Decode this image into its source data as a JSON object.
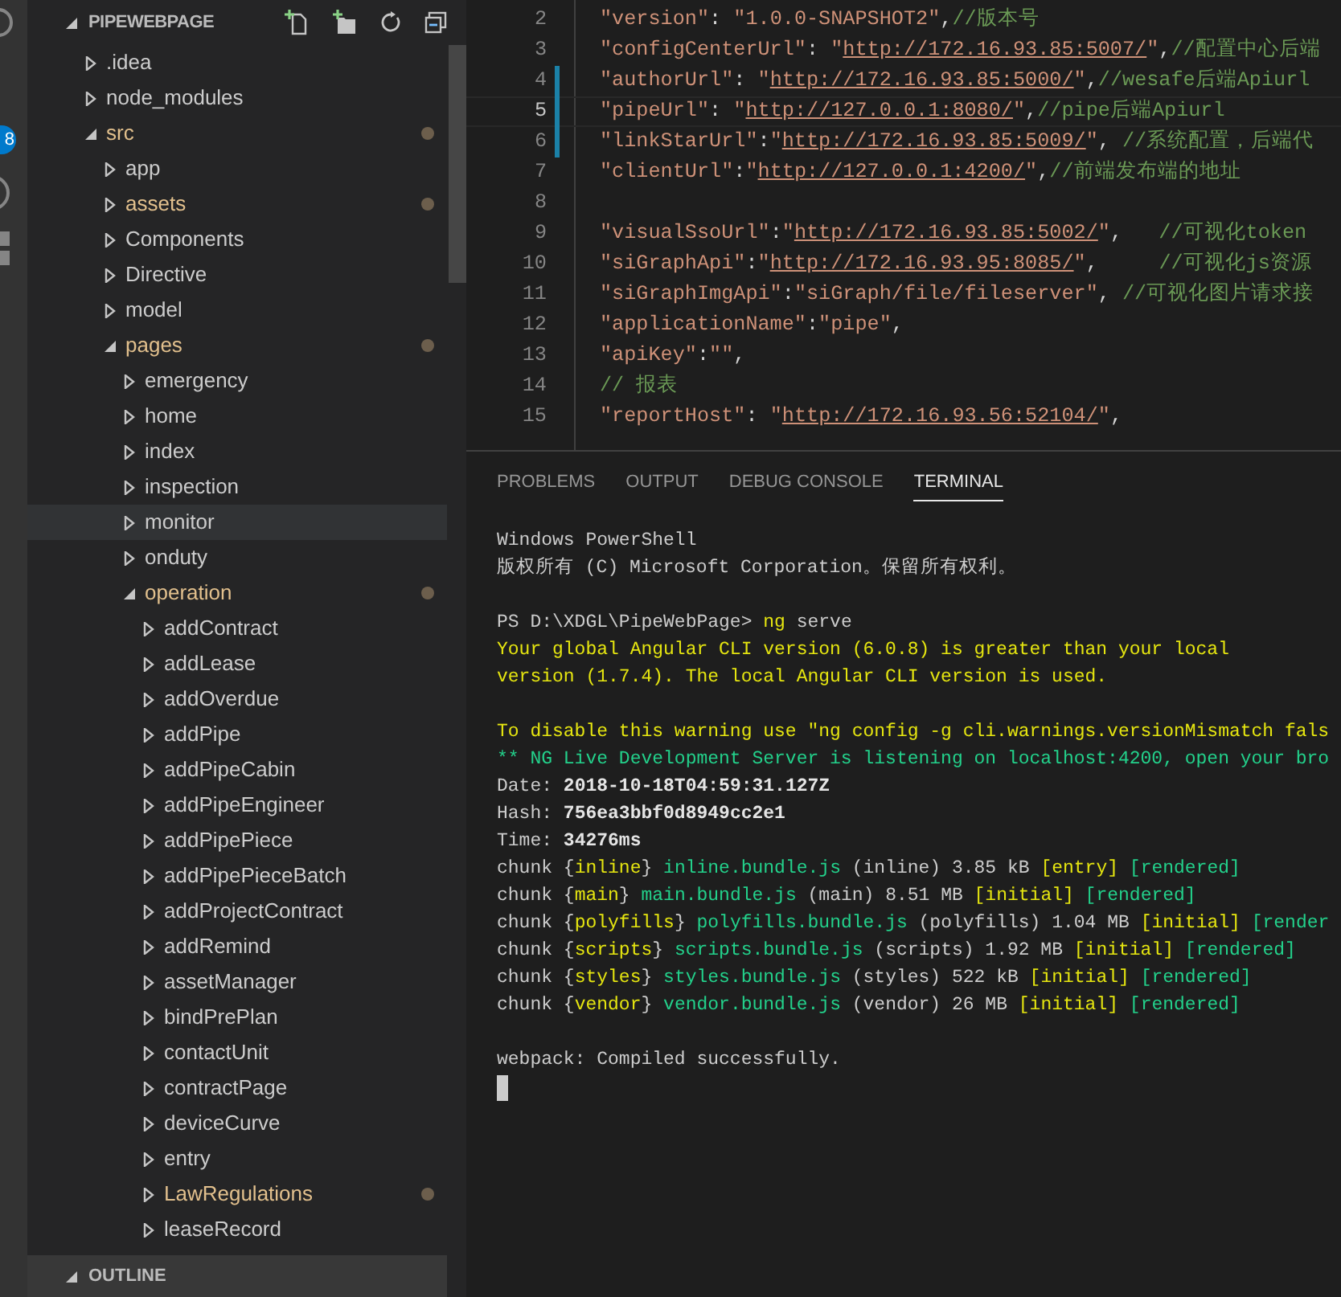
{
  "activity_bar": {
    "badge": "8"
  },
  "explorer": {
    "title": "PIPEWEBPAGE",
    "expanded": true,
    "tree": [
      {
        "label": ".idea",
        "expanded": false,
        "modified": false,
        "hovered": false
      },
      {
        "label": "node_modules",
        "expanded": false,
        "modified": false,
        "hovered": false
      },
      {
        "label": "src",
        "expanded": true,
        "modified": true,
        "hovered": false,
        "children": [
          {
            "label": "app",
            "expanded": false,
            "modified": false,
            "hovered": false
          },
          {
            "label": "assets",
            "expanded": false,
            "modified": true,
            "hovered": false
          },
          {
            "label": "Components",
            "expanded": false,
            "modified": false,
            "hovered": false
          },
          {
            "label": "Directive",
            "expanded": false,
            "modified": false,
            "hovered": false
          },
          {
            "label": "model",
            "expanded": false,
            "modified": false,
            "hovered": false
          },
          {
            "label": "pages",
            "expanded": true,
            "modified": true,
            "hovered": false,
            "children": [
              {
                "label": "emergency",
                "expanded": false,
                "modified": false,
                "hovered": false
              },
              {
                "label": "home",
                "expanded": false,
                "modified": false,
                "hovered": false
              },
              {
                "label": "index",
                "expanded": false,
                "modified": false,
                "hovered": false
              },
              {
                "label": "inspection",
                "expanded": false,
                "modified": false,
                "hovered": false
              },
              {
                "label": "monitor",
                "expanded": false,
                "modified": false,
                "hovered": true
              },
              {
                "label": "onduty",
                "expanded": false,
                "modified": false,
                "hovered": false
              },
              {
                "label": "operation",
                "expanded": true,
                "modified": true,
                "hovered": false,
                "children": [
                  {
                    "label": "addContract",
                    "expanded": false,
                    "modified": false,
                    "hovered": false
                  },
                  {
                    "label": "addLease",
                    "expanded": false,
                    "modified": false,
                    "hovered": false
                  },
                  {
                    "label": "addOverdue",
                    "expanded": false,
                    "modified": false,
                    "hovered": false
                  },
                  {
                    "label": "addPipe",
                    "expanded": false,
                    "modified": false,
                    "hovered": false
                  },
                  {
                    "label": "addPipeCabin",
                    "expanded": false,
                    "modified": false,
                    "hovered": false
                  },
                  {
                    "label": "addPipeEngineer",
                    "expanded": false,
                    "modified": false,
                    "hovered": false
                  },
                  {
                    "label": "addPipePiece",
                    "expanded": false,
                    "modified": false,
                    "hovered": false
                  },
                  {
                    "label": "addPipePieceBatch",
                    "expanded": false,
                    "modified": false,
                    "hovered": false
                  },
                  {
                    "label": "addProjectContract",
                    "expanded": false,
                    "modified": false,
                    "hovered": false
                  },
                  {
                    "label": "addRemind",
                    "expanded": false,
                    "modified": false,
                    "hovered": false
                  },
                  {
                    "label": "assetManager",
                    "expanded": false,
                    "modified": false,
                    "hovered": false
                  },
                  {
                    "label": "bindPrePlan",
                    "expanded": false,
                    "modified": false,
                    "hovered": false
                  },
                  {
                    "label": "contactUnit",
                    "expanded": false,
                    "modified": false,
                    "hovered": false
                  },
                  {
                    "label": "contractPage",
                    "expanded": false,
                    "modified": false,
                    "hovered": false
                  },
                  {
                    "label": "deviceCurve",
                    "expanded": false,
                    "modified": false,
                    "hovered": false
                  },
                  {
                    "label": "entry",
                    "expanded": false,
                    "modified": false,
                    "hovered": false
                  },
                  {
                    "label": "LawRegulations",
                    "expanded": false,
                    "modified": true,
                    "hovered": false
                  },
                  {
                    "label": "leaseRecord",
                    "expanded": false,
                    "modified": false,
                    "hovered": false
                  }
                ]
              }
            ]
          }
        ]
      }
    ]
  },
  "outline": {
    "title": "OUTLINE",
    "expanded": true
  },
  "editor": {
    "lines": [
      {
        "number": "2",
        "current": false,
        "changed": false,
        "segments": [
          {
            "kind": "string",
            "text": "\"version\""
          },
          {
            "kind": "punct",
            "text": ": "
          },
          {
            "kind": "string",
            "text": "\"1.0.0-SNAPSHOT2\""
          },
          {
            "kind": "punct",
            "text": ","
          },
          {
            "kind": "comment",
            "text": "//版本号"
          }
        ]
      },
      {
        "number": "3",
        "current": false,
        "changed": false,
        "segments": [
          {
            "kind": "string",
            "text": "\"configCenterUrl\""
          },
          {
            "kind": "punct",
            "text": ": "
          },
          {
            "kind": "string",
            "text": "\""
          },
          {
            "kind": "link",
            "text": "http://172.16.93.85:5007/"
          },
          {
            "kind": "string",
            "text": "\""
          },
          {
            "kind": "punct",
            "text": ","
          },
          {
            "kind": "comment",
            "text": "//配置中心后端"
          }
        ]
      },
      {
        "number": "4",
        "current": false,
        "changed": true,
        "segments": [
          {
            "kind": "string",
            "text": "\"authorUrl\""
          },
          {
            "kind": "punct",
            "text": ": "
          },
          {
            "kind": "string",
            "text": "\""
          },
          {
            "kind": "link",
            "text": "http://172.16.93.85:5000/"
          },
          {
            "kind": "string",
            "text": "\""
          },
          {
            "kind": "punct",
            "text": ","
          },
          {
            "kind": "comment",
            "text": "//wesafe后端Apiurl"
          }
        ]
      },
      {
        "number": "5",
        "current": true,
        "changed": true,
        "segments": [
          {
            "kind": "string",
            "text": "\"pipeUrl\""
          },
          {
            "kind": "punct",
            "text": ": "
          },
          {
            "kind": "string",
            "text": "\""
          },
          {
            "kind": "link",
            "text": "http://127.0.0.1:8080/"
          },
          {
            "kind": "string",
            "text": "\""
          },
          {
            "kind": "punct",
            "text": ","
          },
          {
            "kind": "comment",
            "text": "//pipe后端Apiurl"
          }
        ]
      },
      {
        "number": "6",
        "current": false,
        "changed": true,
        "segments": [
          {
            "kind": "string",
            "text": "\"linkStarUrl\""
          },
          {
            "kind": "punct",
            "text": ":"
          },
          {
            "kind": "string",
            "text": "\""
          },
          {
            "kind": "link",
            "text": "http://172.16.93.85:5009/"
          },
          {
            "kind": "string",
            "text": "\""
          },
          {
            "kind": "punct",
            "text": ", "
          },
          {
            "kind": "comment",
            "text": "//系统配置，后端代"
          }
        ]
      },
      {
        "number": "7",
        "current": false,
        "changed": false,
        "segments": [
          {
            "kind": "string",
            "text": "\"clientUrl\""
          },
          {
            "kind": "punct",
            "text": ":"
          },
          {
            "kind": "string",
            "text": "\""
          },
          {
            "kind": "link",
            "text": "http://127.0.0.1:4200/"
          },
          {
            "kind": "string",
            "text": "\""
          },
          {
            "kind": "punct",
            "text": ","
          },
          {
            "kind": "comment",
            "text": "//前端发布端的地址"
          }
        ]
      },
      {
        "number": "8",
        "current": false,
        "changed": false
      },
      {
        "number": "9",
        "current": false,
        "changed": false,
        "segments": [
          {
            "kind": "string",
            "text": "\"visualSsoUrl\""
          },
          {
            "kind": "punct",
            "text": ":"
          },
          {
            "kind": "string",
            "text": "\""
          },
          {
            "kind": "link",
            "text": "http://172.16.93.85:5002/"
          },
          {
            "kind": "string",
            "text": "\""
          },
          {
            "kind": "punct",
            "text": ",   "
          },
          {
            "kind": "comment",
            "text": "//可视化token"
          }
        ]
      },
      {
        "number": "10",
        "current": false,
        "changed": false,
        "segments": [
          {
            "kind": "string",
            "text": "\"siGraphApi\""
          },
          {
            "kind": "punct",
            "text": ":"
          },
          {
            "kind": "string",
            "text": "\""
          },
          {
            "kind": "link",
            "text": "http://172.16.93.95:8085/"
          },
          {
            "kind": "string",
            "text": "\""
          },
          {
            "kind": "punct",
            "text": ",     "
          },
          {
            "kind": "comment",
            "text": "//可视化js资源"
          }
        ]
      },
      {
        "number": "11",
        "current": false,
        "changed": false,
        "segments": [
          {
            "kind": "string",
            "text": "\"siGraphImgApi\""
          },
          {
            "kind": "punct",
            "text": ":"
          },
          {
            "kind": "string",
            "text": "\"siGraph/file/fileserver\""
          },
          {
            "kind": "punct",
            "text": ", "
          },
          {
            "kind": "comment",
            "text": "//可视化图片请求接"
          }
        ]
      },
      {
        "number": "12",
        "current": false,
        "changed": false,
        "segments": [
          {
            "kind": "string",
            "text": "\"applicationName\""
          },
          {
            "kind": "punct",
            "text": ":"
          },
          {
            "kind": "string",
            "text": "\"pipe\""
          },
          {
            "kind": "punct",
            "text": ","
          }
        ]
      },
      {
        "number": "13",
        "current": false,
        "changed": false,
        "segments": [
          {
            "kind": "string",
            "text": "\"apiKey\""
          },
          {
            "kind": "punct",
            "text": ":"
          },
          {
            "kind": "string",
            "text": "\"\""
          },
          {
            "kind": "punct",
            "text": ","
          }
        ]
      },
      {
        "number": "14",
        "current": false,
        "changed": false,
        "segments": [
          {
            "kind": "comment",
            "text": "// 报表"
          }
        ]
      },
      {
        "number": "15",
        "current": false,
        "changed": false,
        "segments": [
          {
            "kind": "string",
            "text": "\"reportHost\""
          },
          {
            "kind": "punct",
            "text": ": "
          },
          {
            "kind": "string",
            "text": "\""
          },
          {
            "kind": "link",
            "text": "http://172.16.93.56:52104/"
          },
          {
            "kind": "string",
            "text": "\""
          },
          {
            "kind": "punct",
            "text": ","
          }
        ]
      }
    ]
  },
  "panel": {
    "tabs": [
      {
        "label": "PROBLEMS",
        "selected": false
      },
      {
        "label": "OUTPUT",
        "selected": false
      },
      {
        "label": "DEBUG CONSOLE",
        "selected": false
      },
      {
        "label": "TERMINAL",
        "selected": true
      }
    ],
    "terminal": {
      "blocks": [
        [
          [
            {
              "kind": "plain",
              "text": "Windows PowerShell"
            }
          ],
          [
            {
              "kind": "plain",
              "text": "版权所有 (C) Microsoft Corporation。保留所有权利。"
            }
          ]
        ],
        [
          [
            {
              "kind": "plain",
              "text": "PS D:\\XDGL\\PipeWebPage> "
            },
            {
              "kind": "warning",
              "text": "ng"
            },
            {
              "kind": "plain",
              "text": " serve"
            }
          ],
          [
            {
              "kind": "warning",
              "text": "Your global Angular CLI version (6.0.8) is greater than your local"
            }
          ],
          [
            {
              "kind": "warning",
              "text": "version (1.7.4). The local Angular CLI version is used."
            }
          ]
        ],
        [
          [
            {
              "kind": "warning",
              "text": "To disable this warning use \"ng config -g cli.warnings.versionMismatch fals"
            }
          ],
          [
            {
              "kind": "success",
              "text": "** NG Live Development Server is listening on localhost:4200, open your bro"
            }
          ],
          [
            {
              "kind": "plain",
              "text": "Date: "
            },
            {
              "kind": "emphasis",
              "text": "2018-10-18T04:59:31.127Z"
            }
          ],
          [
            {
              "kind": "plain",
              "text": "Hash: "
            },
            {
              "kind": "emphasis",
              "text": "756ea3bbf0d8949cc2e1"
            }
          ],
          [
            {
              "kind": "plain",
              "text": "Time: "
            },
            {
              "kind": "emphasis",
              "text": "34276ms"
            }
          ],
          [
            {
              "kind": "plain",
              "text": "chunk {"
            },
            {
              "kind": "warning",
              "text": "inline"
            },
            {
              "kind": "plain",
              "text": "} "
            },
            {
              "kind": "success",
              "text": "inline.bundle.js"
            },
            {
              "kind": "plain",
              "text": " (inline) 3.85 kB "
            },
            {
              "kind": "warning",
              "text": "[entry]"
            },
            {
              "kind": "success",
              "text": " [rendered]"
            }
          ],
          [
            {
              "kind": "plain",
              "text": "chunk {"
            },
            {
              "kind": "warning",
              "text": "main"
            },
            {
              "kind": "plain",
              "text": "} "
            },
            {
              "kind": "success",
              "text": "main.bundle.js"
            },
            {
              "kind": "plain",
              "text": " (main) 8.51 MB "
            },
            {
              "kind": "warning",
              "text": "[initial]"
            },
            {
              "kind": "success",
              "text": " [rendered]"
            }
          ],
          [
            {
              "kind": "plain",
              "text": "chunk {"
            },
            {
              "kind": "warning",
              "text": "polyfills"
            },
            {
              "kind": "plain",
              "text": "} "
            },
            {
              "kind": "success",
              "text": "polyfills.bundle.js"
            },
            {
              "kind": "plain",
              "text": " (polyfills) 1.04 MB "
            },
            {
              "kind": "warning",
              "text": "[initial]"
            },
            {
              "kind": "success",
              "text": " [render"
            }
          ],
          [
            {
              "kind": "plain",
              "text": "chunk {"
            },
            {
              "kind": "warning",
              "text": "scripts"
            },
            {
              "kind": "plain",
              "text": "} "
            },
            {
              "kind": "success",
              "text": "scripts.bundle.js"
            },
            {
              "kind": "plain",
              "text": " (scripts) 1.92 MB "
            },
            {
              "kind": "warning",
              "text": "[initial]"
            },
            {
              "kind": "success",
              "text": " [rendered]"
            }
          ],
          [
            {
              "kind": "plain",
              "text": "chunk {"
            },
            {
              "kind": "warning",
              "text": "styles"
            },
            {
              "kind": "plain",
              "text": "} "
            },
            {
              "kind": "success",
              "text": "styles.bundle.js"
            },
            {
              "kind": "plain",
              "text": " (styles) 522 kB "
            },
            {
              "kind": "warning",
              "text": "[initial]"
            },
            {
              "kind": "success",
              "text": " [rendered]"
            }
          ],
          [
            {
              "kind": "plain",
              "text": "chunk {"
            },
            {
              "kind": "warning",
              "text": "vendor"
            },
            {
              "kind": "plain",
              "text": "} "
            },
            {
              "kind": "success",
              "text": "vendor.bundle.js"
            },
            {
              "kind": "plain",
              "text": " (vendor) 26 MB "
            },
            {
              "kind": "warning",
              "text": "[initial]"
            },
            {
              "kind": "success",
              "text": " [rendered]"
            }
          ]
        ],
        [
          [
            {
              "kind": "plain",
              "text": "webpack: Compiled successfully."
            }
          ]
        ]
      ]
    }
  }
}
